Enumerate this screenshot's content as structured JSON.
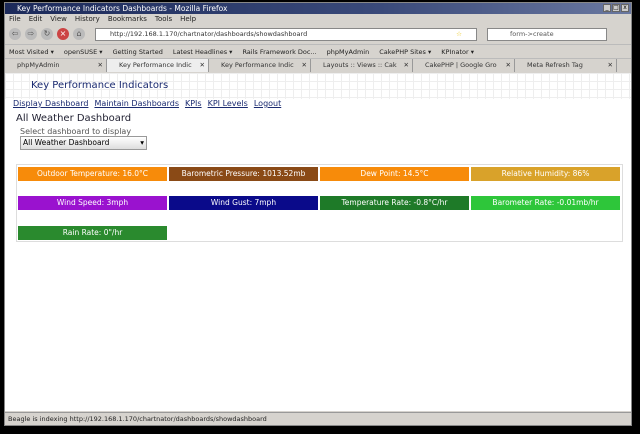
{
  "window": {
    "title": "Key Performance Indicators Dashboards - Mozilla Firefox"
  },
  "menu": [
    "File",
    "Edit",
    "View",
    "History",
    "Bookmarks",
    "Tools",
    "Help"
  ],
  "toolbar": {
    "url": "http://192.168.1.170/chartnator/dashboards/showdashboard",
    "search": "form->create"
  },
  "bookmarks": [
    "Most Visited ▾",
    "openSUSE ▾",
    "Getting Started",
    "Latest Headlines ▾",
    "Rails Framework Doc...",
    "phpMyAdmin",
    "CakePHP Sites ▾",
    "KPInator ▾"
  ],
  "tabs": [
    "phpMyAdmin",
    "Key Performance Indic",
    "Key Performance Indic",
    "Layouts :: Views :: Cak",
    "CakePHP | Google Gro",
    "Meta Refresh Tag"
  ],
  "page": {
    "header": "Key Performance Indicators",
    "nav": [
      "Display Dashboard",
      "Maintain Dashboards",
      "KPIs",
      "KPI Levels",
      "Logout"
    ],
    "title": "All Weather Dashboard",
    "select_label": "Select dashboard to display",
    "select_value": "All Weather Dashboard"
  },
  "tiles": [
    {
      "label": "Outdoor Temperature: 16.0°C",
      "color": "#f78b0a"
    },
    {
      "label": "Barometric Pressure: 1013.52mb",
      "color": "#8a4a16"
    },
    {
      "label": "Dew Point: 14.5°C",
      "color": "#f78b0a"
    },
    {
      "label": "Relative Humidity: 86%",
      "color": "#d9a22a"
    },
    {
      "label": "Wind Speed: 3mph",
      "color": "#9a12cf"
    },
    {
      "label": "Wind Gust: 7mph",
      "color": "#0a0a8a"
    },
    {
      "label": "Temperature Rate: -0.8°C/hr",
      "color": "#1e7a28"
    },
    {
      "label": "Barometer Rate: -0.01mb/hr",
      "color": "#2ec63a"
    },
    {
      "label": "Rain Rate: 0\"/hr",
      "color": "#2a8a2e"
    }
  ],
  "status": "Beagle is indexing http://192.168.1.170/chartnator/dashboards/showdashboard"
}
